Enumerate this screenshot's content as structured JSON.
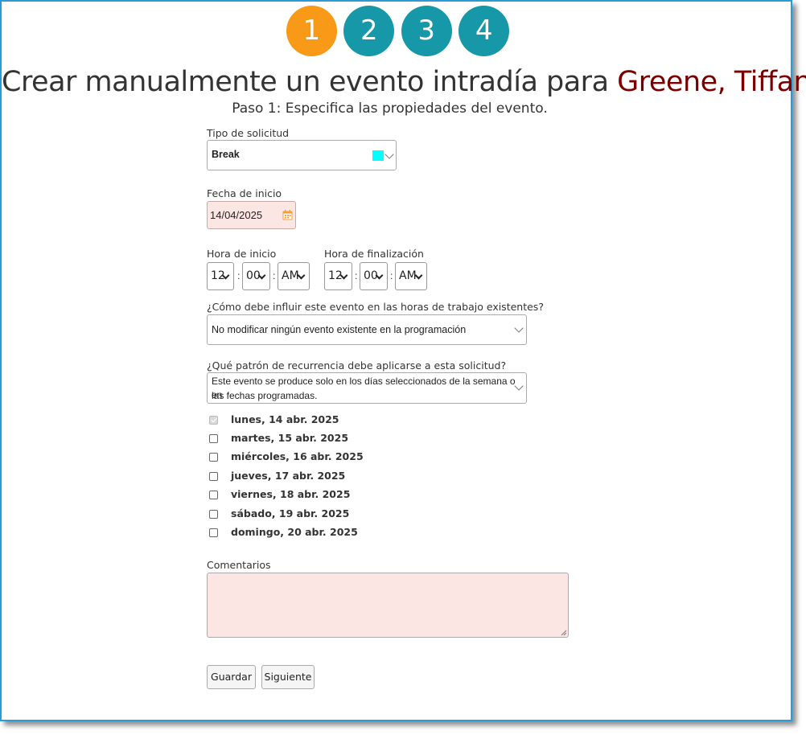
{
  "steps": [
    "1",
    "2",
    "3",
    "4"
  ],
  "title": {
    "prefix": "Crear manualmente un evento intradía para ",
    "employee": "Greene, Tiffany"
  },
  "subtitle": "Paso 1: Especifica las propiedades del evento.",
  "request_type": {
    "label": "Tipo de solicitud",
    "value": "Break",
    "color": "#00ffff"
  },
  "start_date": {
    "label": "Fecha de inicio",
    "value": "14/04/2025"
  },
  "start_time": {
    "label": "Hora de inicio",
    "hour": "12",
    "minute": "00",
    "ampm": "AM"
  },
  "end_time": {
    "label": "Hora de finalización",
    "hour": "12",
    "minute": "00",
    "ampm": "AM"
  },
  "time_separator": ":",
  "impact": {
    "label": "¿Cómo debe influir este evento en las horas de trabajo existentes?",
    "value": "No modificar ningún evento existente en la programación"
  },
  "recurrence": {
    "label": "¿Qué patrón de recurrencia debe aplicarse a esta solicitud?",
    "value_line1": "Este evento se produce solo en los días seleccionados de la semana o en",
    "value_line2": "las fechas programadas."
  },
  "days": [
    {
      "label": "lunes, 14 abr. 2025",
      "checked": true
    },
    {
      "label": "martes, 15 abr. 2025",
      "checked": false
    },
    {
      "label": "miércoles, 16 abr. 2025",
      "checked": false
    },
    {
      "label": "jueves, 17 abr. 2025",
      "checked": false
    },
    {
      "label": "viernes, 18 abr. 2025",
      "checked": false
    },
    {
      "label": "sábado, 19 abr. 2025",
      "checked": false
    },
    {
      "label": "domingo, 20 abr. 2025",
      "checked": false
    }
  ],
  "comments": {
    "label": "Comentarios",
    "value": ""
  },
  "buttons": {
    "save": "Guardar",
    "next": "Siguiente"
  },
  "colors": {
    "step_active": "#f89a17",
    "step_inactive": "#1698a8",
    "name": "#7a0000",
    "required_bg": "#fce6e3",
    "calendar_icon": "#f0a040"
  }
}
